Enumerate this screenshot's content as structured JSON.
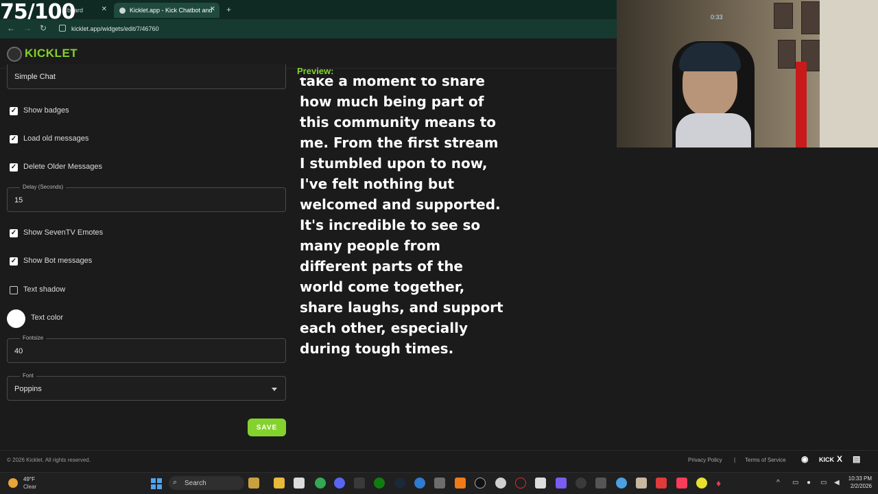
{
  "overlay": {
    "score": "75/100"
  },
  "browser": {
    "tabs": [
      {
        "label": "board",
        "active": false
      },
      {
        "label": "Kicklet.app - Kick Chatbot and",
        "active": true
      }
    ],
    "new_tab_glyph": "+",
    "url": "kicklet.app/widgets/edit/7/46760"
  },
  "app": {
    "logo_text": "KICKLET",
    "brand_color": "#84d22d"
  },
  "form": {
    "style_value": "Simple Chat",
    "checkboxes": [
      {
        "label": "Show badges",
        "checked": true
      },
      {
        "label": "Load old messages",
        "checked": true
      },
      {
        "label": "Delete Older Messages",
        "checked": true
      },
      {
        "label": "Show SevenTV Emotes",
        "checked": true
      },
      {
        "label": "Show Bot messages",
        "checked": true
      },
      {
        "label": "Text shadow",
        "checked": false
      }
    ],
    "delay": {
      "label": "Delay (Seconds)",
      "value": "15"
    },
    "text_color": {
      "label": "Text color",
      "value": "#ffffff"
    },
    "fontsize": {
      "label": "Fontsize",
      "value": "40"
    },
    "font": {
      "label": "Font",
      "value": "Poppins"
    },
    "save_label": "SAVE"
  },
  "preview": {
    "label": "Preview:",
    "text": "take a moment to share how much being part of this community means to me. From the first stream I stumbled upon to now, I've felt nothing but welcomed and supported. It's incredible to see so many people from different parts of the world come together, share laughs, and support each other, especially during tough times."
  },
  "webcam": {
    "clock": "0:33"
  },
  "footer": {
    "copyright": "© 2026 Kicklet. All rights reserved.",
    "privacy": "Privacy Policy",
    "separator": "|",
    "terms": "Terms of Service",
    "kick_label": "KICK",
    "x_label": "X"
  },
  "taskbar": {
    "weather_temp": "49°F",
    "weather_desc": "Clear",
    "search_label": "Search",
    "time": "10:33 PM",
    "date": "2/2/2026"
  }
}
